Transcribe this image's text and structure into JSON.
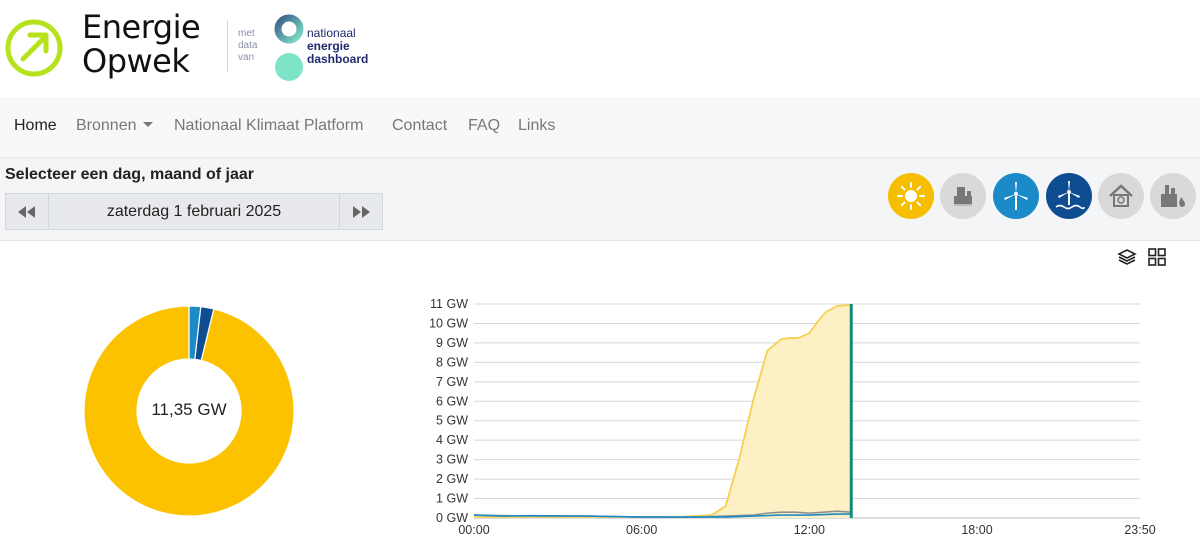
{
  "brand": {
    "logo_line1": "Energie",
    "logo_line2": "Opwek",
    "accent_color": "#b6e21b",
    "partner_prefix": [
      "met",
      "data",
      "van"
    ],
    "partner_name": [
      "nationaal",
      "energie",
      "dashboard"
    ]
  },
  "nav": {
    "items": [
      {
        "label": "Home",
        "active": true
      },
      {
        "label": "Bronnen",
        "dropdown": true
      },
      {
        "label": "Nationaal Klimaat Platform"
      },
      {
        "label": "Contact"
      },
      {
        "label": "FAQ"
      },
      {
        "label": "Links"
      }
    ]
  },
  "selector": {
    "title": "Selecteer een dag, maand of jaar",
    "date": "zaterdag 1 februari 2025",
    "prev_icon": "double-arrow-left-icon",
    "next_icon": "double-arrow-right-icon"
  },
  "sources": [
    {
      "name": "sun-icon",
      "color": "#f5be00",
      "active": true
    },
    {
      "name": "factory-icon",
      "color": "#d9d9d9",
      "active": false
    },
    {
      "name": "wind-turbine-icon",
      "color": "#1b8ac9",
      "active": true
    },
    {
      "name": "offshore-wind-icon",
      "color": "#0e4d91",
      "active": true
    },
    {
      "name": "house-icon",
      "color": "#d9d9d9",
      "active": false
    },
    {
      "name": "industry-icon",
      "color": "#d9d9d9",
      "active": false
    }
  ],
  "tools": [
    "layers-icon",
    "grid-icon"
  ],
  "donut": {
    "total_label": "11,35 GW",
    "segments": [
      {
        "name": "zon",
        "fraction": 0.962,
        "color": "#fcc200"
      },
      {
        "name": "wind-land",
        "fraction": 0.018,
        "color": "#1b8ac9"
      },
      {
        "name": "wind-zee",
        "fraction": 0.02,
        "color": "#0e4d91"
      }
    ]
  },
  "chart_data": {
    "type": "area",
    "y_ticks": [
      "0 GW",
      "1 GW",
      "2 GW",
      "3 GW",
      "4 GW",
      "5 GW",
      "6 GW",
      "7 GW",
      "8 GW",
      "9 GW",
      "10 GW",
      "11 GW"
    ],
    "x_ticks": [
      "00:00",
      "06:00",
      "12:00",
      "18:00",
      "23:50"
    ],
    "ylim": [
      0,
      11
    ],
    "x_range_hours": [
      0,
      23.833
    ],
    "now_hour": 13.5,
    "grid": true,
    "series": [
      {
        "color": "#f7cf52",
        "fill": "#fdf0c4",
        "x": [
          0,
          2,
          4,
          6,
          7.5,
          8.5,
          9,
          9.5,
          10,
          10.5,
          11,
          11.3,
          11.6,
          12,
          12.3,
          12.6,
          13,
          13.5
        ],
        "y": [
          0.05,
          0.05,
          0.05,
          0.05,
          0.07,
          0.15,
          0.6,
          3.1,
          6.1,
          8.6,
          9.2,
          9.25,
          9.25,
          9.5,
          10.1,
          10.6,
          10.9,
          10.95
        ]
      },
      {
        "color": "#8f8f8f",
        "x": [
          0,
          2,
          4,
          6,
          8,
          9,
          10,
          10.5,
          11,
          11.5,
          12,
          12.5,
          13,
          13.5
        ],
        "y": [
          0.15,
          0.1,
          0.1,
          0.05,
          0.05,
          0.1,
          0.15,
          0.25,
          0.3,
          0.3,
          0.25,
          0.3,
          0.35,
          0.3
        ]
      },
      {
        "color": "#1b8ac9",
        "x": [
          0,
          1,
          2,
          4,
          6,
          8,
          9,
          10,
          11,
          12,
          13,
          13.5
        ],
        "y": [
          0.15,
          0.1,
          0.12,
          0.1,
          0.05,
          0.05,
          0.05,
          0.1,
          0.15,
          0.15,
          0.2,
          0.2
        ]
      }
    ]
  }
}
